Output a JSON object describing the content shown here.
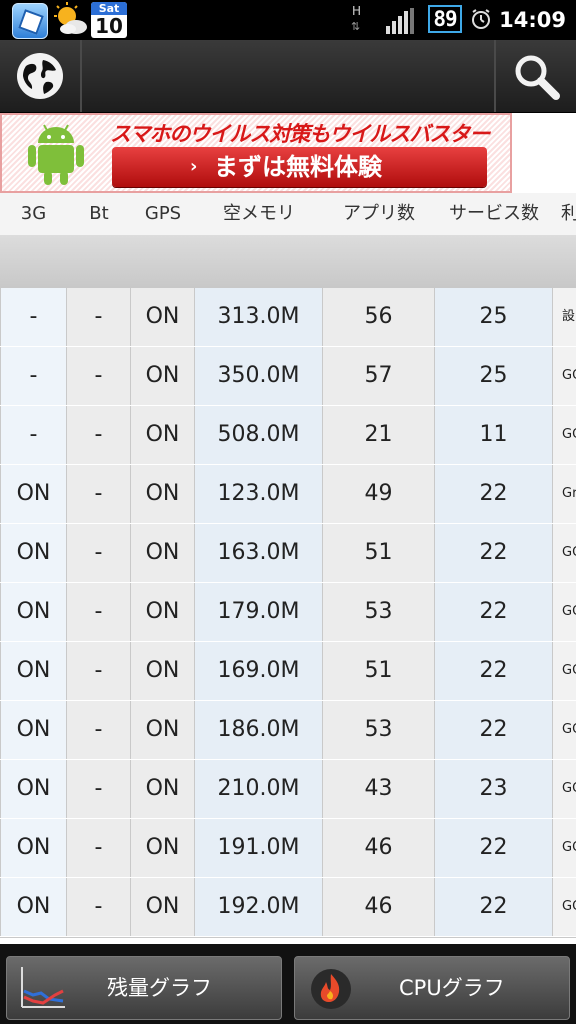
{
  "status_bar": {
    "calendar_day": "Sat",
    "calendar_date": "10",
    "network_type": "H",
    "network_arrows": "⇅",
    "battery_level": "89",
    "time": "14:09",
    "icons": [
      "app-cube-icon",
      "weather-sun-cloud-icon",
      "calendar-icon",
      "signal-icon",
      "battery-icon",
      "alarm-clock-icon"
    ]
  },
  "action_bar": {
    "left_icon": "globe-icon",
    "right_icon": "search-icon"
  },
  "ad": {
    "headline": "スマホのウイルス対策もウイルスバスター",
    "button_arrow": "›",
    "button_label": "まずは無料体験",
    "icon": "android-robot-icon"
  },
  "table": {
    "columns": [
      "3G",
      "Bt",
      "GPS",
      "空メモリ",
      "アプリ数",
      "サービス数",
      "利"
    ],
    "rows": [
      {
        "g3": "-",
        "bt": "-",
        "gps": "ON",
        "mem": "313.0M",
        "apps": "56",
        "svc": "25",
        "use": "設"
      },
      {
        "g3": "-",
        "bt": "-",
        "gps": "ON",
        "mem": "350.0M",
        "apps": "57",
        "svc": "25",
        "use": "GO"
      },
      {
        "g3": "-",
        "bt": "-",
        "gps": "ON",
        "mem": "508.0M",
        "apps": "21",
        "svc": "11",
        "use": "GO"
      },
      {
        "g3": "ON",
        "bt": "-",
        "gps": "ON",
        "mem": "123.0M",
        "apps": "49",
        "svc": "22",
        "use": "Gr"
      },
      {
        "g3": "ON",
        "bt": "-",
        "gps": "ON",
        "mem": "163.0M",
        "apps": "51",
        "svc": "22",
        "use": "GO"
      },
      {
        "g3": "ON",
        "bt": "-",
        "gps": "ON",
        "mem": "179.0M",
        "apps": "53",
        "svc": "22",
        "use": "GO"
      },
      {
        "g3": "ON",
        "bt": "-",
        "gps": "ON",
        "mem": "169.0M",
        "apps": "51",
        "svc": "22",
        "use": "GO"
      },
      {
        "g3": "ON",
        "bt": "-",
        "gps": "ON",
        "mem": "186.0M",
        "apps": "53",
        "svc": "22",
        "use": "GO"
      },
      {
        "g3": "ON",
        "bt": "-",
        "gps": "ON",
        "mem": "210.0M",
        "apps": "43",
        "svc": "23",
        "use": "GO"
      },
      {
        "g3": "ON",
        "bt": "-",
        "gps": "ON",
        "mem": "191.0M",
        "apps": "46",
        "svc": "22",
        "use": "GO"
      },
      {
        "g3": "ON",
        "bt": "-",
        "gps": "ON",
        "mem": "192.0M",
        "apps": "46",
        "svc": "22",
        "use": "GO"
      }
    ]
  },
  "bottom_bar": {
    "remaining_graph_label": "残量グラフ",
    "remaining_graph_icon": "line-graph-icon",
    "cpu_graph_label": "CPUグラフ",
    "cpu_graph_icon": "cpu-flame-icon"
  }
}
